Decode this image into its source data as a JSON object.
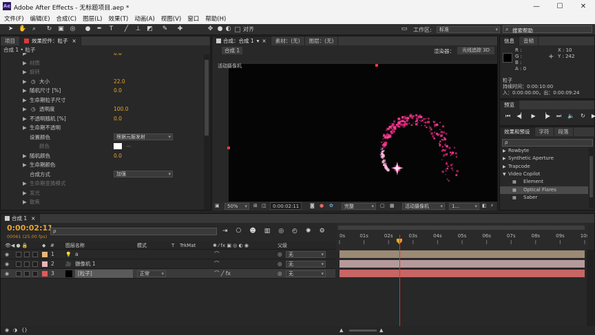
{
  "app": {
    "title": "Adobe After Effects - 无标题项目.aep *",
    "logo": "Ae"
  },
  "window_buttons": [
    "—",
    "☐",
    "✕"
  ],
  "menu": [
    "文件(F)",
    "编辑(E)",
    "合成(C)",
    "图层(L)",
    "效果(T)",
    "动画(A)",
    "视图(V)",
    "窗口",
    "帮助(H)"
  ],
  "toolbar": {
    "align_label": "对齐",
    "workspace_label": "工作区:",
    "workspace_value": "标准",
    "search_placeholder": "搜索帮助"
  },
  "left_panel": {
    "tabs": [
      "项目",
      "效果控件：粒子"
    ],
    "breadcrumb": "合成 1 • 粒子",
    "props": [
      {
        "name": "",
        "value": "0.0",
        "dim": false,
        "cut": true
      },
      {
        "name": "材质",
        "value": "",
        "dim": true
      },
      {
        "name": "旋转",
        "value": "",
        "dim": true
      },
      {
        "name": "大小",
        "value": "22.0",
        "dim": false,
        "stopwatch": true
      },
      {
        "name": "随机尺寸 [%]",
        "value": "0.0",
        "dim": false
      },
      {
        "name": "生命期粒子尺寸",
        "value": "",
        "dim": false
      },
      {
        "name": "透明度",
        "value": "100.0",
        "dim": false,
        "stopwatch": true
      },
      {
        "name": "不透明随机 [%]",
        "value": "0.0",
        "dim": false
      },
      {
        "name": "生命期不透明",
        "value": "",
        "dim": false
      },
      {
        "name": "设置颜色",
        "value": "",
        "dim": false,
        "select": "根据元服发射"
      },
      {
        "name": "颜色",
        "value": "",
        "dim": true,
        "swatch": true
      },
      {
        "name": "随机颜色",
        "value": "0.0",
        "dim": false
      },
      {
        "name": "生命期颜色",
        "value": "",
        "dim": false
      },
      {
        "name": "合成方式",
        "value": "",
        "dim": false,
        "select": "加强"
      },
      {
        "name": "生命期变换模式",
        "value": "",
        "dim": true
      },
      {
        "name": "发光",
        "value": "",
        "dim": true
      },
      {
        "name": "散焦",
        "value": "",
        "dim": true
      }
    ]
  },
  "comp_panel": {
    "tab": "合成：合成 1",
    "footage_tab": "素材：(无)",
    "layer_tab": "图层：(无)",
    "comp_name": "合成 1",
    "renderer_label": "渲染器：",
    "renderer_value": "光线追踪 3D",
    "camera_label": "活动摄像机",
    "footer": {
      "zoom": "50%",
      "timecode": "0:00:02:11",
      "quality": "完整",
      "view": "活动摄像机",
      "views": "1..."
    }
  },
  "info_panel": {
    "tabs": [
      "信息",
      "音频"
    ],
    "r": "R :",
    "g": "G :",
    "b": "B :",
    "a": "A : 0",
    "x": "X : 10",
    "y": "Y : 242",
    "layer": "粒子",
    "duration": "持续时间：0:00:10:00",
    "io": "入：0:00:00:00，出：0:00:09:24"
  },
  "preview_panel": {
    "tab": "预览"
  },
  "effects_panel": {
    "tabs": [
      "效果和预设",
      "字符",
      "段落"
    ],
    "search_placeholder": "ρ",
    "items": [
      {
        "label": "Rowbyte",
        "indent": 0,
        "arrow": "▶"
      },
      {
        "label": "Synthetic Aperture",
        "indent": 0,
        "arrow": "▶"
      },
      {
        "label": "Trapcode",
        "indent": 0,
        "arrow": "▶"
      },
      {
        "label": "Video Copilot",
        "indent": 0,
        "arrow": "▼"
      },
      {
        "label": "Element",
        "indent": 1,
        "arrow": ""
      },
      {
        "label": "Optical Flares",
        "indent": 1,
        "arrow": "",
        "selected": true
      },
      {
        "label": "Saber",
        "indent": 1,
        "arrow": ""
      }
    ]
  },
  "timeline": {
    "tab": "合成 1",
    "timecode": "0:00:02:11",
    "frames": "00061 (25.00 fps)",
    "search_placeholder": "ρ",
    "columns": {
      "name": "图层名称",
      "mode": "模式",
      "t": "T",
      "trkmat": "TrkMat",
      "parent": "父级"
    },
    "layers": [
      {
        "num": "1",
        "name": "a",
        "color": "#e7b77a",
        "mode": "",
        "parent": "无",
        "kind": "light"
      },
      {
        "num": "2",
        "name": "摄像机 1",
        "color": "#e8b6b8",
        "mode": "",
        "parent": "无",
        "kind": "camera"
      },
      {
        "num": "3",
        "name": "[粒子]",
        "color": "#e05a5a",
        "mode": "正常",
        "parent": "无",
        "kind": "solid",
        "selected": true
      }
    ],
    "ticks": [
      "0s",
      "01s",
      "02s",
      "03s",
      "04s",
      "05s",
      "06s",
      "07s",
      "08s",
      "09s",
      "10s"
    ],
    "playhead_seconds": 2.44,
    "duration_seconds": 10,
    "track_colors": [
      "#9b8a74",
      "#b69a9b",
      "#c86565"
    ]
  }
}
